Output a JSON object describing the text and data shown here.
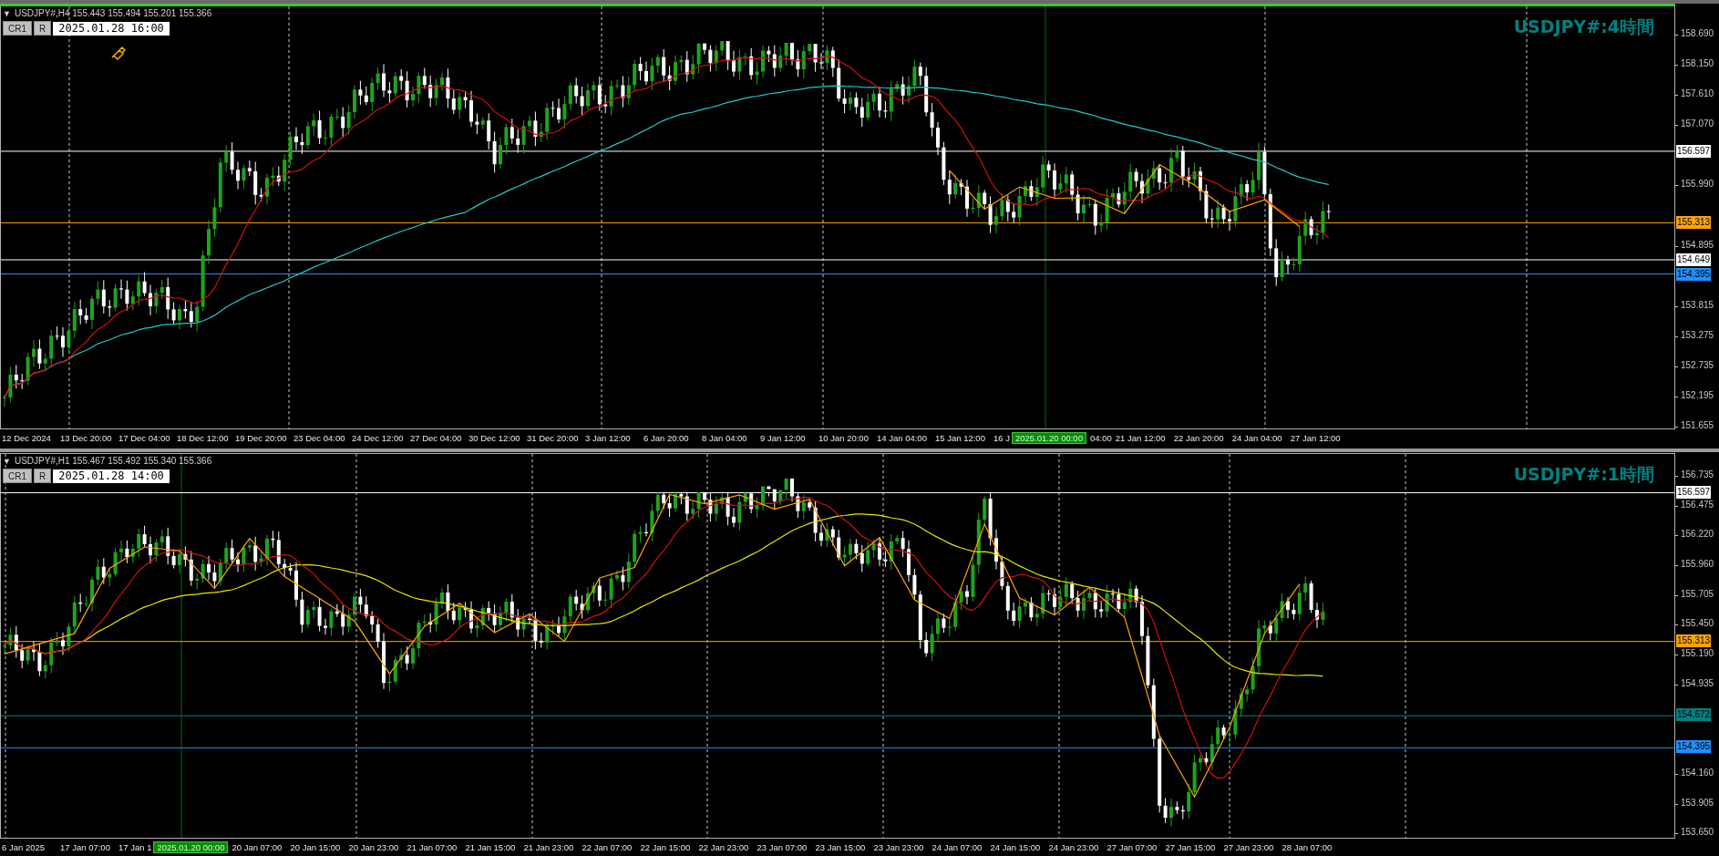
{
  "panels": [
    {
      "collapse_glyph": "▼",
      "symbol_line": "USDJPY#,H4  155.443 155.494 155.201 155.366",
      "buttons": [
        "CR1",
        "R"
      ],
      "date_field": "2025.01.28 16:00",
      "title": "USDJPY#:4時間",
      "price_ticks": [
        "158.690",
        "158.150",
        "157.610",
        "157.070",
        "155.990",
        "154.895",
        "153.815",
        "153.275",
        "152.735",
        "152.195",
        "151.655"
      ],
      "price_lines": [
        {
          "value": "156.597",
          "color": "#ffffff"
        },
        {
          "value": "155.313",
          "color": "#ffa500"
        },
        {
          "value": "154.649",
          "color": "#ffffff"
        },
        {
          "value": "154.395",
          "color": "#1e90ff"
        }
      ],
      "time_labels": [
        {
          "text": "12 Dec 2024",
          "kind": "time"
        },
        {
          "text": "13 Dec 20:00",
          "kind": "time"
        },
        {
          "text": "17 Dec 04:00",
          "kind": "time"
        },
        {
          "text": "18 Dec 12:00",
          "kind": "time"
        },
        {
          "text": "19 Dec 20:00",
          "kind": "time"
        },
        {
          "text": "23 Dec 04:00",
          "kind": "time"
        },
        {
          "text": "24 Dec 12:00",
          "kind": "time"
        },
        {
          "text": "27 Dec 04:00",
          "kind": "time"
        },
        {
          "text": "30 Dec 12:00",
          "kind": "time"
        },
        {
          "text": "31 Dec 20:00",
          "kind": "time"
        },
        {
          "text": "3 Jan 12:00",
          "kind": "time"
        },
        {
          "text": "6 Jan 20:00",
          "kind": "time"
        },
        {
          "text": "8 Jan 04:00",
          "kind": "time"
        },
        {
          "text": "9 Jan 12:00",
          "kind": "time"
        },
        {
          "text": "10 Jan 20:00",
          "kind": "time"
        },
        {
          "text": "14 Jan 04:00",
          "kind": "time"
        },
        {
          "text": "15 Jan 12:00",
          "kind": "time"
        },
        {
          "text": "16 J",
          "kind": "partial"
        },
        {
          "text": "2025.01.20 00:00",
          "kind": "cursor"
        },
        {
          "text": "04:00",
          "kind": "partial"
        },
        {
          "text": "21 Jan 12:00",
          "kind": "time"
        },
        {
          "text": "22 Jan 20:00",
          "kind": "time"
        },
        {
          "text": "24 Jan 04:00",
          "kind": "time"
        },
        {
          "text": "27 Jan 12:00",
          "kind": "time"
        }
      ]
    },
    {
      "collapse_glyph": "▼",
      "symbol_line": "USDJPY#,H1  155.467 155.492 155.340 155.366",
      "buttons": [
        "CR1",
        "R"
      ],
      "date_field": "2025.01.28 14:00",
      "title": "USDJPY#:1時間",
      "price_ticks": [
        "156.735",
        "156.475",
        "156.220",
        "155.960",
        "155.705",
        "155.450",
        "155.190",
        "154.935",
        "154.160",
        "153.905",
        "153.650"
      ],
      "price_lines": [
        {
          "value": "156.597",
          "color": "#ffffff"
        },
        {
          "value": "155.313",
          "color": "#ffa500"
        },
        {
          "value": "154.672",
          "color": "#008080"
        },
        {
          "value": "154.395",
          "color": "#1e90ff"
        }
      ],
      "time_labels": [
        {
          "text": "6 Jan 2025",
          "kind": "time"
        },
        {
          "text": "17 Jan 07:00",
          "kind": "time"
        },
        {
          "text": "17 Jan 1",
          "kind": "partial"
        },
        {
          "text": "2025.01.20 00:00",
          "kind": "cursor"
        },
        {
          "text": "20 Jan 07:00",
          "kind": "time"
        },
        {
          "text": "20 Jan 15:00",
          "kind": "time"
        },
        {
          "text": "20 Jan 23:00",
          "kind": "time"
        },
        {
          "text": "21 Jan 07:00",
          "kind": "time"
        },
        {
          "text": "21 Jan 15:00",
          "kind": "time"
        },
        {
          "text": "21 Jan 23:00",
          "kind": "time"
        },
        {
          "text": "22 Jan 07:00",
          "kind": "time"
        },
        {
          "text": "22 Jan 15:00",
          "kind": "time"
        },
        {
          "text": "22 Jan 23:00",
          "kind": "time"
        },
        {
          "text": "23 Jan 07:00",
          "kind": "time"
        },
        {
          "text": "23 Jan 15:00",
          "kind": "time"
        },
        {
          "text": "23 Jan 23:00",
          "kind": "time"
        },
        {
          "text": "24 Jan 07:00",
          "kind": "time"
        },
        {
          "text": "24 Jan 15:00",
          "kind": "time"
        },
        {
          "text": "24 Jan 23:00",
          "kind": "time"
        },
        {
          "text": "27 Jan 07:00",
          "kind": "time"
        },
        {
          "text": "27 Jan 15:00",
          "kind": "time"
        },
        {
          "text": "27 Jan 23:00",
          "kind": "time"
        },
        {
          "text": "28 Jan 07:00",
          "kind": "time"
        }
      ]
    }
  ]
}
